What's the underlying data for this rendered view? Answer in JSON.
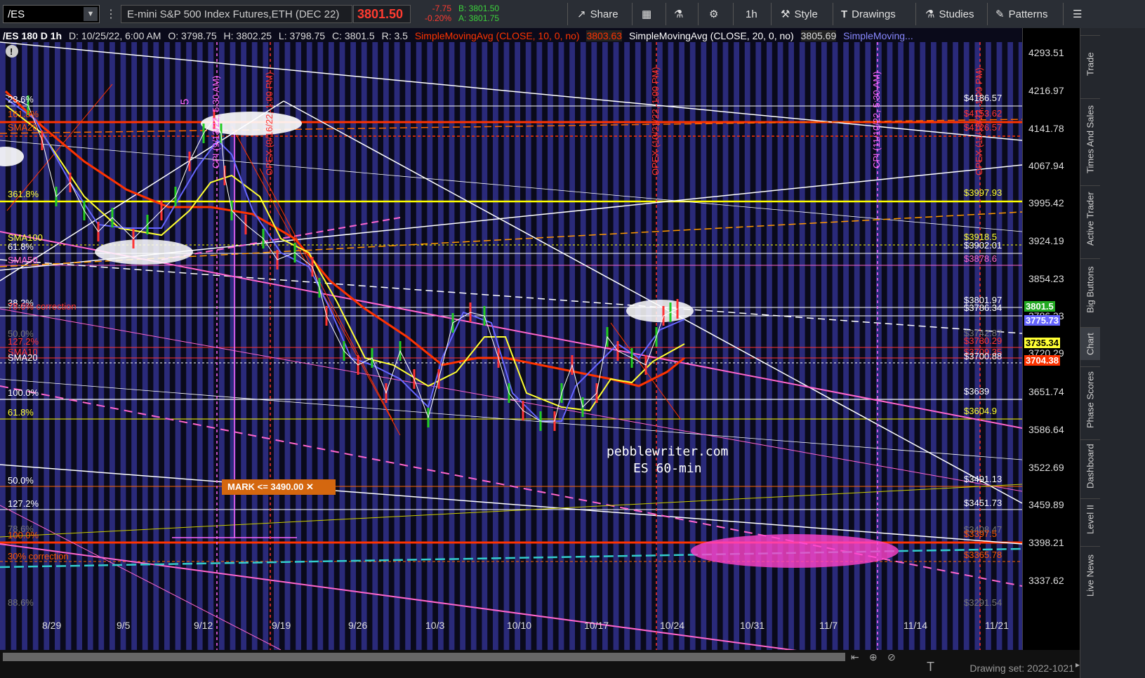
{
  "toolbar": {
    "symbol": "/ES",
    "description": "E-mini S&P 500 Index Futures,ETH (DEC 22)",
    "last": "3801.50",
    "change": "-7.75",
    "change_pct": "-0.20%",
    "bid": "B: 3801.50",
    "ask": "A: 3801.75",
    "share": "Share",
    "timeframe": "1h",
    "style": "Style",
    "drawings": "Drawings",
    "studies": "Studies",
    "patterns": "Patterns"
  },
  "legend": {
    "head": "/ES 180 D 1h",
    "date": "D: 10/25/22, 6:00 AM",
    "open": "O: 3798.75",
    "high": "H: 3802.25",
    "low": "L: 3798.75",
    "close": "C: 3801.5",
    "range": "R: 3.5",
    "sma10": "SimpleMovingAvg (CLOSE, 10, 0, no)",
    "sma10_val": "3803.63",
    "sma20": "SimpleMovingAvg (CLOSE, 20, 0, no)",
    "sma20_val": "3805.69",
    "sma_more": "SimpleMoving..."
  },
  "yaxis": [
    "4293.51",
    "4216.97",
    "4141.78",
    "4067.94",
    "3995.42",
    "3924.19",
    "3854.23",
    "3786.33",
    "3720.29",
    "3651.74",
    "3586.64",
    "3522.69",
    "3459.89",
    "3398.21",
    "3337.62"
  ],
  "xaxis": [
    "8/29",
    "9/5",
    "9/12",
    "9/19",
    "9/26",
    "10/3",
    "10/10",
    "10/17",
    "10/24",
    "10/31",
    "11/7",
    "11/14",
    "11/21"
  ],
  "left_labels": [
    {
      "text": "23.6%",
      "color": "#ffffff"
    },
    {
      "text": "161.8%",
      "color": "#ff5500"
    },
    {
      "text": "SMA20",
      "color": "#ff5500"
    },
    {
      "text": "361.8%",
      "color": "#ffff33"
    },
    {
      "text": "SMA100",
      "color": "#ffff33"
    },
    {
      "text": "61.8%",
      "color": "#ffffff"
    },
    {
      "text": "SMA50",
      "color": "#ff66cc"
    },
    {
      "text": "38.2%",
      "color": "#ffffff"
    },
    {
      "text": "78.6% correction",
      "color": "#ff3333"
    },
    {
      "text": "50.0%",
      "color": "#777777"
    },
    {
      "text": "127.2%",
      "color": "#ff3333"
    },
    {
      "text": "SMA10",
      "color": "#ff3333"
    },
    {
      "text": "SMA20",
      "color": "#ffffff"
    },
    {
      "text": "100.0%",
      "color": "#ffffff"
    },
    {
      "text": "61.8%",
      "color": "#ffff33"
    },
    {
      "text": "50.0%",
      "color": "#ffffff"
    },
    {
      "text": "127.2%",
      "color": "#ffffff"
    },
    {
      "text": "78.6%",
      "color": "#777777"
    },
    {
      "text": "100.0%",
      "color": "#ff5500"
    },
    {
      "text": "30% correction",
      "color": "#ff5500"
    },
    {
      "text": "88.6%",
      "color": "#777777"
    }
  ],
  "right_levels": [
    {
      "text": "$4186.57",
      "color": "#ffffff"
    },
    {
      "text": "$4153.62",
      "color": "#ff3333"
    },
    {
      "text": "$4126.57",
      "color": "#ff3333"
    },
    {
      "text": "$3997.93",
      "color": "#ffff33"
    },
    {
      "text": "$3918.5",
      "color": "#ffff33"
    },
    {
      "text": "$3902.01",
      "color": "#ffffff"
    },
    {
      "text": "$3878.6",
      "color": "#ff66cc"
    },
    {
      "text": "$3801.97",
      "color": "#ffffff"
    },
    {
      "text": "$3786.34",
      "color": "#ffffff"
    },
    {
      "text": "$3742.87",
      "color": "#777777"
    },
    {
      "text": "$3730.29",
      "color": "#ff3333"
    },
    {
      "text": "$3709.35",
      "color": "#ff3333"
    },
    {
      "text": "$3700.88",
      "color": "#ffffff"
    },
    {
      "text": "$3639",
      "color": "#ffffff"
    },
    {
      "text": "$3604.9",
      "color": "#ffff33"
    },
    {
      "text": "$3491.13",
      "color": "#ffffff"
    },
    {
      "text": "$3451.73",
      "color": "#ffffff"
    },
    {
      "text": "$3408.47",
      "color": "#777777"
    },
    {
      "text": "$3397.5",
      "color": "#ff5500"
    },
    {
      "text": "$3365.78",
      "color": "#ff5500"
    },
    {
      "text": "$3291.54",
      "color": "#777777"
    }
  ],
  "price_pills": [
    {
      "text": "3801.5",
      "bg": "#22aa22",
      "fg": "#ffffff"
    },
    {
      "text": "3775.73",
      "bg": "#6666ff",
      "fg": "#ffffff"
    },
    {
      "text": "3735.34",
      "bg": "#ffff33",
      "fg": "#000000"
    },
    {
      "text": "3704.38",
      "bg": "#ff3300",
      "fg": "#ffffff"
    }
  ],
  "vertical_labels": [
    {
      "text": "CPI (9/13/22, 5:30 AM)",
      "color": "#ff66ff"
    },
    {
      "text": "OPEX (9/16/22, 1:00 PM)",
      "color": "#ff3333"
    },
    {
      "text": "OPEX (10/21/22, 1:00 PM)",
      "color": "#ff3333"
    },
    {
      "text": "CPI (11/10/22, 5:30 AM)",
      "color": "#ff66ff"
    },
    {
      "text": "OPEX (11/18/22, 1:00 PM)",
      "color": "#ff3333"
    }
  ],
  "wave_label": "5",
  "mark": "MARK <= 3490.00 ✕",
  "watermark": [
    "pebblewriter.com",
    "ES 60-min"
  ],
  "drawing_set": "Drawing set: 2022-1021",
  "right_tabs": [
    "Trade",
    "Times And Sales",
    "Active Trader",
    "Big Buttons",
    "Chart",
    "Phase Scores",
    "Dashboard",
    "Level II",
    "Live News"
  ]
}
